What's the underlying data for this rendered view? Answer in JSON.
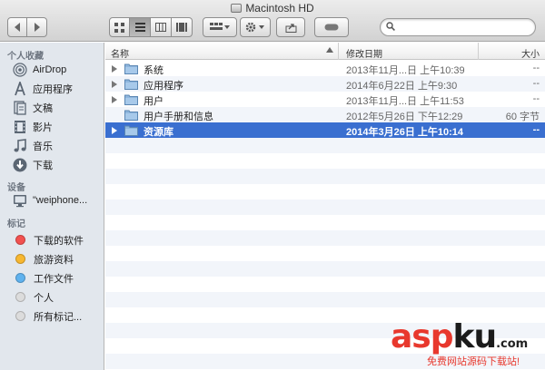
{
  "window": {
    "title": "Macintosh HD"
  },
  "search": {
    "value": "",
    "placeholder": ""
  },
  "sidebar": {
    "favorites_header": "个人收藏",
    "favorites": [
      {
        "label": "AirDrop",
        "icon": "airdrop-icon"
      },
      {
        "label": "应用程序",
        "icon": "applications-icon"
      },
      {
        "label": "文稿",
        "icon": "documents-icon"
      },
      {
        "label": "影片",
        "icon": "movies-icon"
      },
      {
        "label": "音乐",
        "icon": "music-icon"
      },
      {
        "label": "下载",
        "icon": "downloads-icon"
      }
    ],
    "devices_header": "设备",
    "devices": [
      {
        "label": "\"weiphone...",
        "icon": "computer-icon"
      }
    ],
    "tags_header": "标记",
    "tags": [
      {
        "label": "下载的软件",
        "color": "#f2514f"
      },
      {
        "label": "旅游资料",
        "color": "#f7b731"
      },
      {
        "label": "工作文件",
        "color": "#5fb2ee"
      },
      {
        "label": "个人",
        "color": "#dcdcdc"
      },
      {
        "label": "所有标记...",
        "color": "#dcdcdc"
      }
    ]
  },
  "columns": {
    "name": "名称",
    "date": "修改日期",
    "size": "大小"
  },
  "files": [
    {
      "name": "系统",
      "date": "2013年11月...日 上午10:39",
      "size": "--",
      "has_disclosure": true,
      "selected": false
    },
    {
      "name": "应用程序",
      "date": "2014年6月22日 上午9:30",
      "size": "--",
      "has_disclosure": true,
      "selected": false
    },
    {
      "name": "用户",
      "date": "2013年11月...日 上午11:53",
      "size": "--",
      "has_disclosure": true,
      "selected": false
    },
    {
      "name": "用户手册和信息",
      "date": "2012年5月26日 下午12:29",
      "size": "60 字节",
      "has_disclosure": false,
      "selected": false
    },
    {
      "name": "资源库",
      "date": "2014年3月26日 上午10:14",
      "size": "--",
      "has_disclosure": true,
      "selected": true
    }
  ],
  "watermark": {
    "asp": "asp",
    "ku": "ku",
    "com": ".com",
    "sub": "免费网站源码下载站!"
  },
  "colors": {
    "selection": "#3a6fd0",
    "sidebar_bg": "#e2e7ed",
    "stripe": "#f2f5fa"
  }
}
